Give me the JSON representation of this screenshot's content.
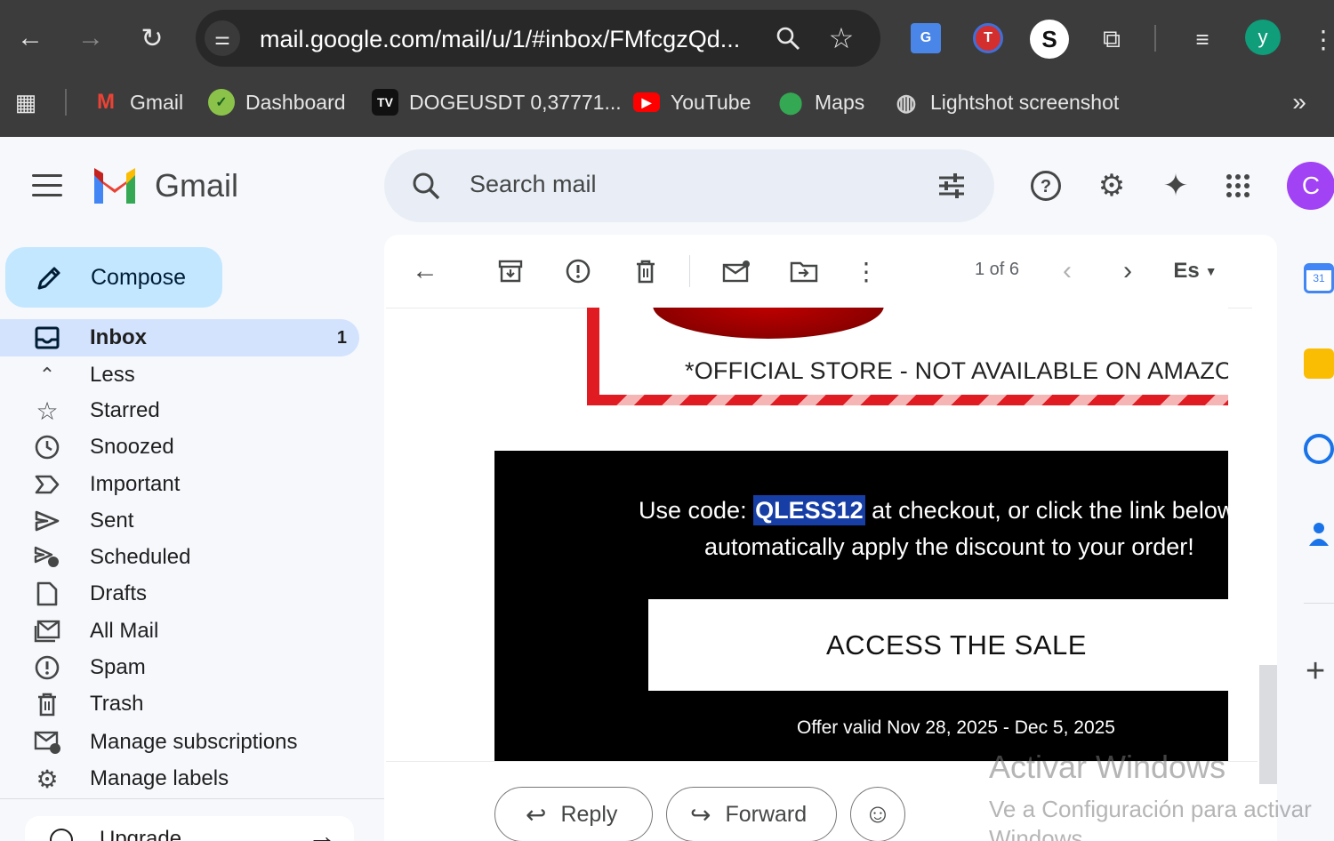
{
  "browser": {
    "url": "mail.google.com/mail/u/1/#inbox/FMfcgzQd...",
    "profile_initial": "y",
    "bookmarks": [
      {
        "label": "Gmail"
      },
      {
        "label": "Dashboard"
      },
      {
        "label": "DOGEUSDT 0,37771..."
      },
      {
        "label": "YouTube"
      },
      {
        "label": "Maps"
      },
      {
        "label": "Lightshot screenshot"
      }
    ],
    "more_bookmarks": "»"
  },
  "header": {
    "app_name": "Gmail",
    "search_placeholder": "Search mail",
    "account_initial": "C"
  },
  "sidebar": {
    "compose_label": "Compose",
    "items": [
      {
        "label": "Inbox",
        "count": "1"
      },
      {
        "label": "Less"
      },
      {
        "label": "Starred"
      },
      {
        "label": "Snoozed"
      },
      {
        "label": "Important"
      },
      {
        "label": "Sent"
      },
      {
        "label": "Scheduled"
      },
      {
        "label": "Drafts"
      },
      {
        "label": "All Mail"
      },
      {
        "label": "Spam"
      },
      {
        "label": "Trash"
      },
      {
        "label": "Manage subscriptions"
      },
      {
        "label": "Manage labels"
      }
    ],
    "upgrade_label": "Upgrade"
  },
  "toolbar": {
    "pager": "1 of 6",
    "language": "Es"
  },
  "email": {
    "official_notice": "*OFFICIAL STORE - NOT AVAILABLE ON AMAZON",
    "code_prefix": "Use code: ",
    "code": "QLESS12",
    "code_suffix": " at checkout, or click the link below",
    "line2": "automatically apply the discount to your order!",
    "cta": "ACCESS THE SALE",
    "offer_dates": "Offer valid Nov 28, 2025 - Dec 5, 2025"
  },
  "actions": {
    "reply": "Reply",
    "forward": "Forward"
  },
  "watermark": {
    "line1": "Activar Windows",
    "line2": "Ve a Configuración para activar",
    "line3": "Windows."
  },
  "colors": {
    "accent": "#c2e7ff",
    "active_nav": "#d3e3fd",
    "avatar": "#a142f4",
    "brand_red": "#e11b22"
  }
}
